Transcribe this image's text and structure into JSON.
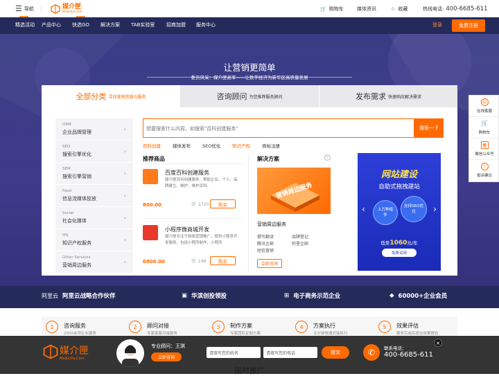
{
  "topbar": {
    "menu_label": "导航",
    "logo_text": "媒介匣",
    "logo_sub": "MeiJieXia.Com",
    "logo_badge": "NEW",
    "hot_badge": "HOT",
    "cart": "购物车",
    "media_news": "媒体资讯",
    "favorite": "收藏",
    "hotline_label": "热线电话:",
    "hotline": "400-6685-611"
  },
  "nav": {
    "items": [
      "精选活动",
      "产品中心",
      "快选GO",
      "解决方案",
      "TAB实验室",
      "招商加盟",
      "服务中心"
    ],
    "login": "登录",
    "register": "免费注册"
  },
  "hero": {
    "title": "让营销更简单",
    "subtitle": "委员风采：媒介匣高军——让数字经济为新华区高质量发展"
  },
  "tabs": [
    {
      "label": "全部分类",
      "sub": "寻找营销资源与服务"
    },
    {
      "label": "咨询顾问",
      "sub": "为您推荐服务顾问"
    },
    {
      "label": "发布需求",
      "sub": "快速响应解决需求"
    }
  ],
  "sidebar": [
    {
      "en": "ORM",
      "cn": "企业品牌管理"
    },
    {
      "en": "SEO",
      "cn": "搜索引擎优化"
    },
    {
      "en": "SEM",
      "cn": "搜索引擎营销"
    },
    {
      "en": "Feed",
      "cn": "信息流媒体投放"
    },
    {
      "en": "Social",
      "cn": "社会化媒体"
    },
    {
      "en": "IPS",
      "cn": "知识产权服务"
    },
    {
      "en": "Other Services",
      "cn": "营销周边服务"
    }
  ],
  "search": {
    "placeholder": "想要搜索什么内容，如搜索\"百科创建服务\"",
    "button": "搜索一下",
    "tags": [
      "百科创建",
      "媒体发布",
      "SEO优化",
      "知识产权",
      "商标注册"
    ]
  },
  "recommend": {
    "title": "推荐商品",
    "items": [
      {
        "name": "百度百科创建服务",
        "desc": "媒介匣百科创建服务，帮助企业、个人、品牌建立、维护、维护百科。",
        "price": "800.00",
        "sales": "1720",
        "buy": "购买"
      },
      {
        "name": "小程序微商城开发",
        "desc": "媒介匣专注于网络营销推广，提供小程序开发服务，包括小程序制作，小程序",
        "price": "6800.00",
        "sales": "148",
        "buy": "购买"
      }
    ]
  },
  "solutions": {
    "title": "解决方案",
    "img_text": "营销周边服务",
    "caption": "营销周边服务",
    "links": [
      "撰写翻译",
      "品牌登记",
      "腾讯企邮",
      "阿里企邮",
      "短信营销"
    ],
    "consult": "立即咨询"
  },
  "banner": {
    "title": "网站建设",
    "sub": "自助式拖拽建站",
    "left_circle": "上万种组件",
    "right_circle": "支持SEO优化",
    "price_prefix": "低至",
    "price": "1060",
    "price_suffix": "元/年",
    "btn": "免费试用"
  },
  "right_sidebar": [
    "在线客服",
    "购物车",
    "微信公众号",
    "投诉建议"
  ],
  "partners": [
    {
      "logo": "阿里云",
      "text": "阿里云战略合作伙伴"
    },
    {
      "logo": "",
      "text": "华滨创投领投"
    },
    {
      "logo": "",
      "text": "电子商务示范企业"
    },
    {
      "logo": "",
      "text": "60000+企业会员"
    }
  ],
  "steps": [
    {
      "num": "1",
      "title": "咨询服务",
      "sub": "2000余项企业服务"
    },
    {
      "num": "2",
      "title": "顾问对接",
      "sub": "专家客服对接服务"
    },
    {
      "num": "3",
      "title": "制作方案",
      "sub": "专家团队定制方案"
    },
    {
      "num": "4",
      "title": "方案执行",
      "sub": "五分钟快速对接执行"
    },
    {
      "num": "5",
      "title": "效果评估",
      "sub": "服务完成后提交效果报告"
    }
  ],
  "footer": {
    "logo": "媒介匣",
    "logo_sub": "MeiJieXia.Com",
    "consultant_label": "专业顾问：王琪",
    "consult_btn": "立即咨询",
    "name_placeholder": "请填写您的姓名",
    "phone_placeholder": "请填写您的电话",
    "submit": "提交",
    "phone_label": "联系电话：",
    "phone": "400-6685-611",
    "behind_text": "限时推广"
  }
}
